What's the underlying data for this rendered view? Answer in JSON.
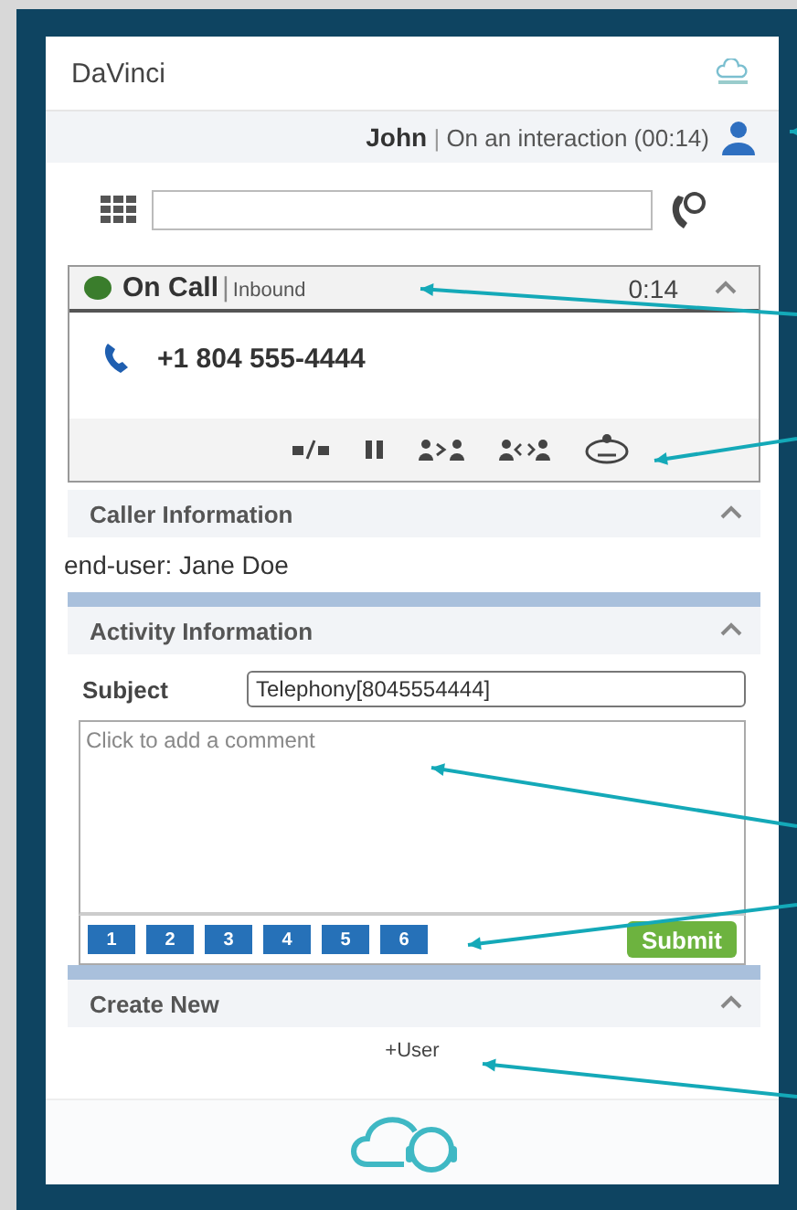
{
  "header": {
    "title": "DaVinci"
  },
  "agent": {
    "name": "John",
    "separator": "|",
    "status": "On an interaction (00:14)"
  },
  "call": {
    "status": "On Call",
    "separator": "|",
    "direction": "Inbound",
    "timer": "0:14",
    "expanded": true,
    "number": "+1 804 555-4444"
  },
  "sections": [
    {
      "kind": "caller",
      "title": "Caller Information",
      "expanded": true,
      "text": "end-user: Jane Doe"
    },
    {
      "kind": "activity",
      "title": "Activity Information",
      "expanded": true,
      "subject_label": "Subject",
      "subject_value": "Telephony[8045554444]",
      "comment_placeholder": "Click to add a comment",
      "codes": [
        "1",
        "2",
        "3",
        "4",
        "5",
        "6"
      ],
      "submit": "Submit"
    },
    {
      "kind": "create",
      "title": "Create New",
      "expanded": true,
      "link": "+User"
    }
  ]
}
